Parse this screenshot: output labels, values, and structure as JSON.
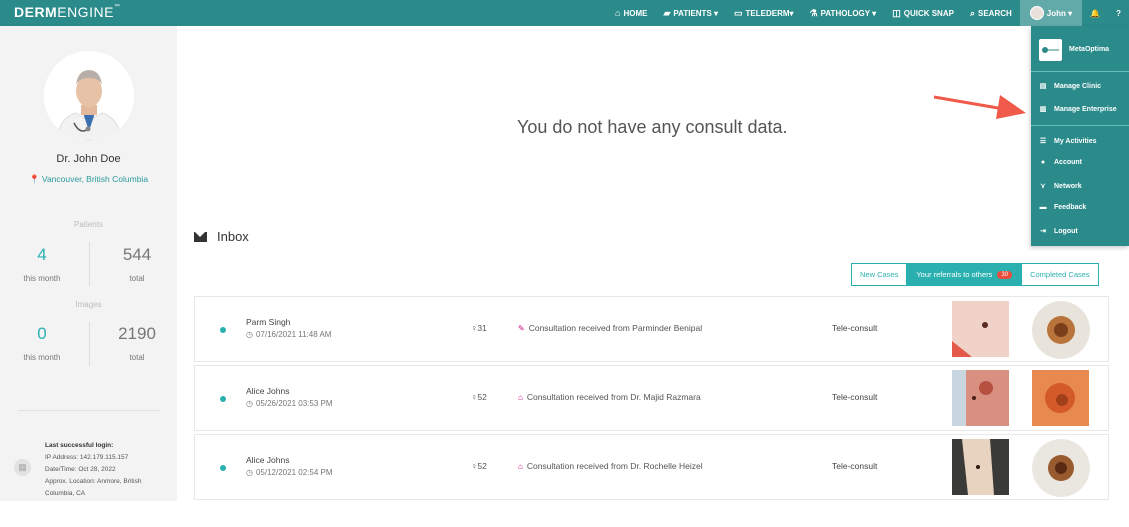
{
  "brand": {
    "bold": "DERM",
    "light": "ENGINE",
    "tm": "™"
  },
  "nav": {
    "home": "HOME",
    "patients": "PATIENTS ▾",
    "telederm": "TELEDERM▾",
    "pathology": "PATHOLOGY ▾",
    "quick_snap": "QUICK SNAP",
    "search": "SEARCH",
    "user": "John ▾",
    "help": "?"
  },
  "profile": {
    "name": "Dr. John Doe",
    "location": "Vancouver, British Columbia"
  },
  "stats": {
    "patients_label": "Patients",
    "patients_month": "4",
    "patients_month_cap": "this month",
    "patients_total": "544",
    "patients_total_cap": "total",
    "images_label": "Images",
    "images_month": "0",
    "images_month_cap": "this month",
    "images_total": "2190",
    "images_total_cap": "total"
  },
  "login": {
    "title": "Last successful login:",
    "ip": "IP Address: 142.179.115.157",
    "datetime": "Date/Time: Oct 28, 2022",
    "location": "Approx. Location: Anmore, British Columbia, CA"
  },
  "main": {
    "empty_message": "You do not have any consult data.",
    "inbox_title": "Inbox"
  },
  "tabs": {
    "new_cases": "New Cases",
    "referrals": "Your referrals to others",
    "referrals_count": "30",
    "completed": "Completed Cases"
  },
  "rows": [
    {
      "name": "Parm Singh",
      "date": "07/16/2021 11:48 AM",
      "age": "31",
      "gender_icon": "female-icon",
      "consult": "Consultation received from Parminder Benipal",
      "type": "Tele-consult"
    },
    {
      "name": "Alice Johns",
      "date": "05/26/2021 03:53 PM",
      "age": "52",
      "gender_icon": "female-icon",
      "consult": "Consultation received from Dr. Majid Razmara",
      "type": "Tele-consult"
    },
    {
      "name": "Alice Johns",
      "date": "05/12/2021 02:54 PM",
      "age": "52",
      "gender_icon": "female-icon",
      "consult": "Consultation received from Dr. Rochelle Heizel",
      "type": "Tele-consult"
    }
  ],
  "dropdown": {
    "org": "MetaOptima",
    "items": [
      "Manage Clinic",
      "Manage Enterprise",
      "My Activities",
      "Account",
      "Network",
      "Feedback",
      "Logout"
    ]
  },
  "colors": {
    "primary": "#2b8a8a",
    "accent": "#2bb0b0",
    "badge": "#e74c3c",
    "arrow": "#f05a4a"
  }
}
